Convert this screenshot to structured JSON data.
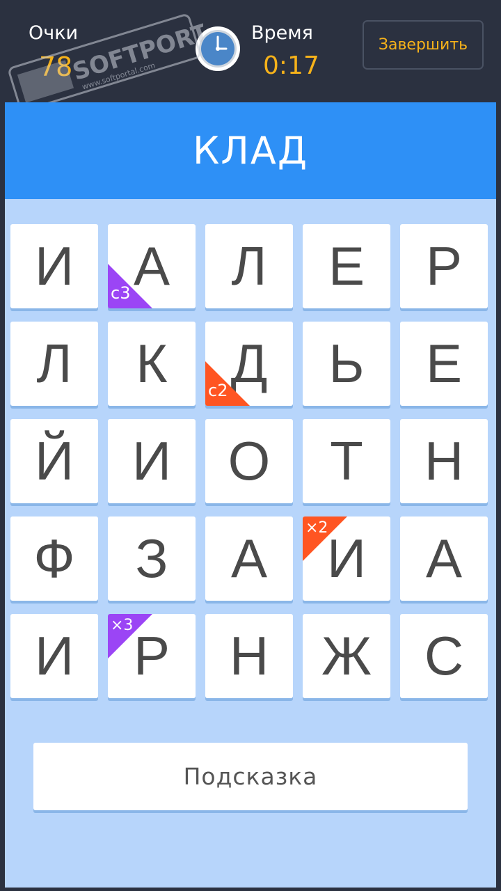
{
  "header": {
    "score_label": "Очки",
    "score_value": "78",
    "time_label": "Время",
    "time_value": "0:17",
    "finish_label": "Завершить"
  },
  "watermark": {
    "brand": "SOFTPORTAL",
    "url": "www.softportal.com",
    "tm": "™"
  },
  "word": "КЛАД",
  "grid": {
    "rows": 5,
    "cols": 5,
    "tiles": [
      {
        "letter": "И"
      },
      {
        "letter": "А",
        "badge": {
          "text": "с3",
          "color": "#9b45f5",
          "corner": "bottom-left"
        }
      },
      {
        "letter": "Л"
      },
      {
        "letter": "Е"
      },
      {
        "letter": "Р"
      },
      {
        "letter": "Л"
      },
      {
        "letter": "К"
      },
      {
        "letter": "Д",
        "badge": {
          "text": "с2",
          "color": "#ff5522",
          "corner": "bottom-left"
        }
      },
      {
        "letter": "Ь"
      },
      {
        "letter": "Е"
      },
      {
        "letter": "Й"
      },
      {
        "letter": "И"
      },
      {
        "letter": "О"
      },
      {
        "letter": "Т"
      },
      {
        "letter": "Н"
      },
      {
        "letter": "Ф"
      },
      {
        "letter": "З"
      },
      {
        "letter": "А"
      },
      {
        "letter": "И",
        "badge": {
          "text": "×2",
          "color": "#ff5522",
          "corner": "top-left"
        }
      },
      {
        "letter": "А"
      },
      {
        "letter": "И"
      },
      {
        "letter": "Р",
        "badge": {
          "text": "×3",
          "color": "#9b45f5",
          "corner": "top-left"
        }
      },
      {
        "letter": "Н"
      },
      {
        "letter": "Ж"
      },
      {
        "letter": "С"
      }
    ]
  },
  "hint_label": "Подсказка",
  "colors": {
    "header_bg": "#2b3140",
    "accent": "#f6b21a",
    "word_bar": "#2e90f6",
    "board_bg": "#b7d5fb",
    "purple_badge": "#9b45f5",
    "orange_badge": "#ff5522"
  },
  "icons": {
    "clock": "clock-icon"
  }
}
